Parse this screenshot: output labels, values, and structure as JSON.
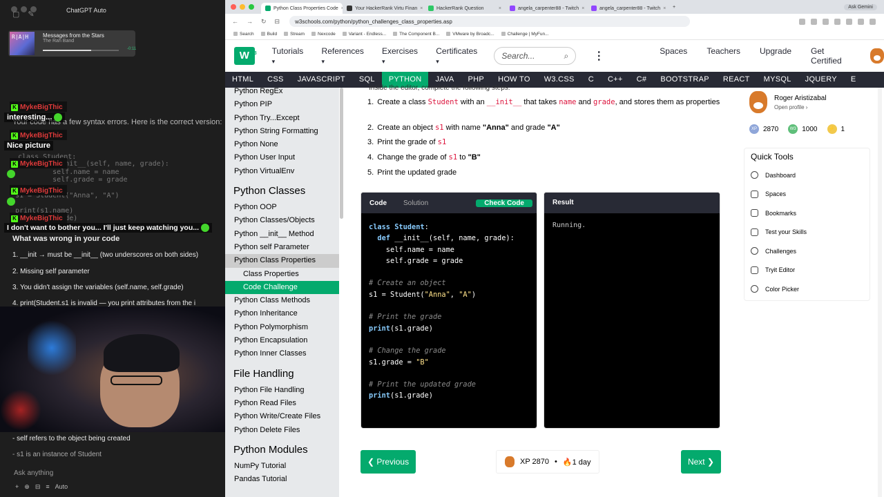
{
  "left_panel": {
    "app_title": "ChatGPT Auto",
    "music": {
      "art_text": "R|A|H",
      "title": "Messages from the Stars",
      "artist": "The Rah Band",
      "time": "-0:11"
    },
    "chat_overlay": [
      {
        "name": "MykeBigThic",
        "message": "interesting..."
      },
      {
        "name": "MykeBigThic",
        "message": "Nice picture"
      },
      {
        "name": "MykeBigThic",
        "message": ""
      },
      {
        "name": "MykeBigThic",
        "message": ""
      },
      {
        "name": "MykeBigThic",
        "message": "I don't want to bother you... I'll just keep watching you..."
      }
    ],
    "gpt_text": {
      "intro": "Your code has a few syntax errors. Here is the correct version:",
      "heading": "What was wrong in your code",
      "points": [
        "1. __init → must be __init__ (two underscores on both sides)",
        "2. Missing self parameter",
        "3. You didn't assign the variables (self.name, self.grade)",
        "4. print(Student.s1 is invalid — you print attributes from the i"
      ],
      "note1": "- self refers to the object being created",
      "note2": "- s1 is an instance of Student"
    },
    "ghost_code": [
      "class Student:",
      "    def __init__(self, name, grade):",
      "        self.name = name",
      "        self.grade = grade",
      "s1 = Student(\"Anna\", \"A\")",
      "print(s1.name)",
      "print(s1.grade)"
    ],
    "composer_placeholder": "Ask anything",
    "composer_tools": [
      "+",
      "⊕",
      "⊟",
      "≡",
      "Auto"
    ]
  },
  "browser": {
    "tabs": [
      {
        "title": "Python Class Properties Code",
        "color": "#04aa6d",
        "active": true
      },
      {
        "title": "Your HackerRank Virtu Finan",
        "color": "#333"
      },
      {
        "title": "HackerRank Question",
        "color": "#2ec866"
      },
      {
        "title": "angela_carpenter88 - Twitch",
        "color": "#9146ff"
      },
      {
        "title": "angela_carpenter88 - Twitch",
        "color": "#9146ff"
      }
    ],
    "ask_gemini": "Ask Gemini",
    "url": "w3schools.com/python/python_challenges_class_properties.asp",
    "bookmarks": [
      "Search",
      "Build",
      "Stream",
      "Nexcode",
      "Variant - Endless...",
      "The Component B...",
      "VMware by Broadc...",
      "Challenge | MyFun..."
    ]
  },
  "w3": {
    "logo": "W",
    "logo_sup": "3",
    "logo_sub": "schools",
    "menu": [
      "Tutorials",
      "References",
      "Exercises",
      "Certificates"
    ],
    "search_placeholder": "Search...",
    "right_links": [
      "Spaces",
      "Teachers",
      "Upgrade",
      "Get Certified"
    ],
    "topnav": [
      "HTML",
      "CSS",
      "JAVASCRIPT",
      "SQL",
      "PYTHON",
      "JAVA",
      "PHP",
      "HOW TO",
      "W3.CSS",
      "C",
      "C++",
      "C#",
      "BOOTSTRAP",
      "REACT",
      "MYSQL",
      "JQUERY",
      "E"
    ],
    "topnav_active": "PYTHON"
  },
  "sidebar": {
    "items_top": [
      "Python RegEx",
      "Python PIP",
      "Python Try...Except",
      "Python String Formatting",
      "Python None",
      "Python User Input",
      "Python VirtualEnv"
    ],
    "heading_classes": "Python Classes",
    "items_classes": [
      "Python OOP",
      "Python Classes/Objects",
      "Python __init__ Method",
      "Python self Parameter",
      "Python Class Properties"
    ],
    "sub_items": [
      "Class Properties",
      "Code Challenge"
    ],
    "items_classes2": [
      "Python Class Methods",
      "Python Inheritance",
      "Python Polymorphism",
      "Python Encapsulation",
      "Python Inner Classes"
    ],
    "heading_files": "File Handling",
    "items_files": [
      "Python File Handling",
      "Python Read Files",
      "Python Write/Create Files",
      "Python Delete Files"
    ],
    "heading_modules": "Python Modules",
    "items_modules": [
      "NumPy Tutorial",
      "Pandas Tutorial"
    ]
  },
  "challenge": {
    "cut_text": "Inside the editor, complete the following steps:",
    "steps": [
      {
        "n": "1.",
        "parts": [
          "Create a class ",
          "Student",
          " with an ",
          "__init__",
          " that takes ",
          "name",
          " and ",
          "grade",
          ", and stores them as properties"
        ]
      },
      {
        "n": "2.",
        "parts": [
          "Create an object ",
          "s1",
          " with name ",
          "\"Anna\"",
          " and grade ",
          "\"A\""
        ]
      },
      {
        "n": "3.",
        "parts": [
          "Print the grade of ",
          "s1"
        ]
      },
      {
        "n": "4.",
        "parts": [
          "Change the grade of ",
          "s1",
          " to ",
          "\"B\""
        ]
      },
      {
        "n": "5.",
        "parts": [
          "Print the updated grade"
        ]
      }
    ],
    "code_tab": "Code",
    "solution_tab": "Solution",
    "check_button": "Check Code",
    "result_title": "Result",
    "result_text": "Running.",
    "code_lines": [
      "class Student:",
      "  def __init__(self, name, grade):",
      "    self.name = name",
      "    self.grade = grade",
      "",
      "# Create an object",
      "s1 = Student(\"Anna\", \"A\")",
      "",
      "# Print the grade",
      "print(s1.grade)",
      "",
      "# Change the grade",
      "s1.grade = \"B\"",
      "",
      "# Print the updated grade",
      "print(s1.grade)"
    ],
    "prev_button": "❮ Previous",
    "next_button": "Next ❯",
    "xp_label": "XP 2870",
    "streak": "1 day"
  },
  "profile": {
    "name": "Roger Aristizabal",
    "link": "Open profile ›",
    "stats": [
      {
        "icon": "XP",
        "value": "2870",
        "color": "#8fa6d9"
      },
      {
        "icon": "W3",
        "value": "1000",
        "color": "#5fbf7a"
      },
      {
        "icon": "⚡",
        "value": "1",
        "color": "#f2c94c"
      }
    ],
    "quick_tools_title": "Quick Tools",
    "quick_tools": [
      "Dashboard",
      "Spaces",
      "Bookmarks",
      "Test your Skills",
      "Challenges",
      "Tryit Editor",
      "Color Picker"
    ]
  }
}
